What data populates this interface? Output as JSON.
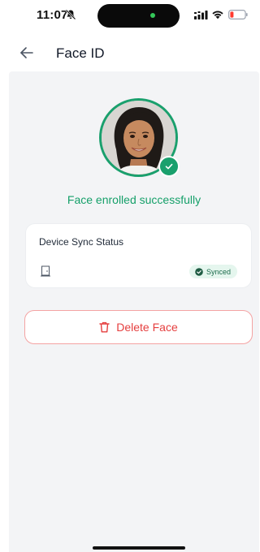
{
  "status_bar": {
    "time": "11:07",
    "icons": [
      "bell-slash-icon",
      "signal-icon",
      "wifi-icon",
      "battery-low-icon"
    ]
  },
  "header": {
    "title": "Face ID",
    "back_icon": "arrow-left-icon"
  },
  "enrollment": {
    "message": "Face enrolled successfully",
    "badge_icon": "check-icon"
  },
  "sync_card": {
    "title": "Device Sync Status",
    "device_icon": "door-icon",
    "status": "Synced",
    "status_icon": "check-circle-icon"
  },
  "actions": {
    "delete_label": "Delete Face",
    "delete_icon": "trash-icon"
  },
  "colors": {
    "success": "#1aa06d",
    "danger": "#e53e3e",
    "danger_border": "#f4a3a3",
    "surface": "#f3f4f6",
    "badge_bg": "#e5f6ee",
    "battery_low": "#ff3b30"
  }
}
